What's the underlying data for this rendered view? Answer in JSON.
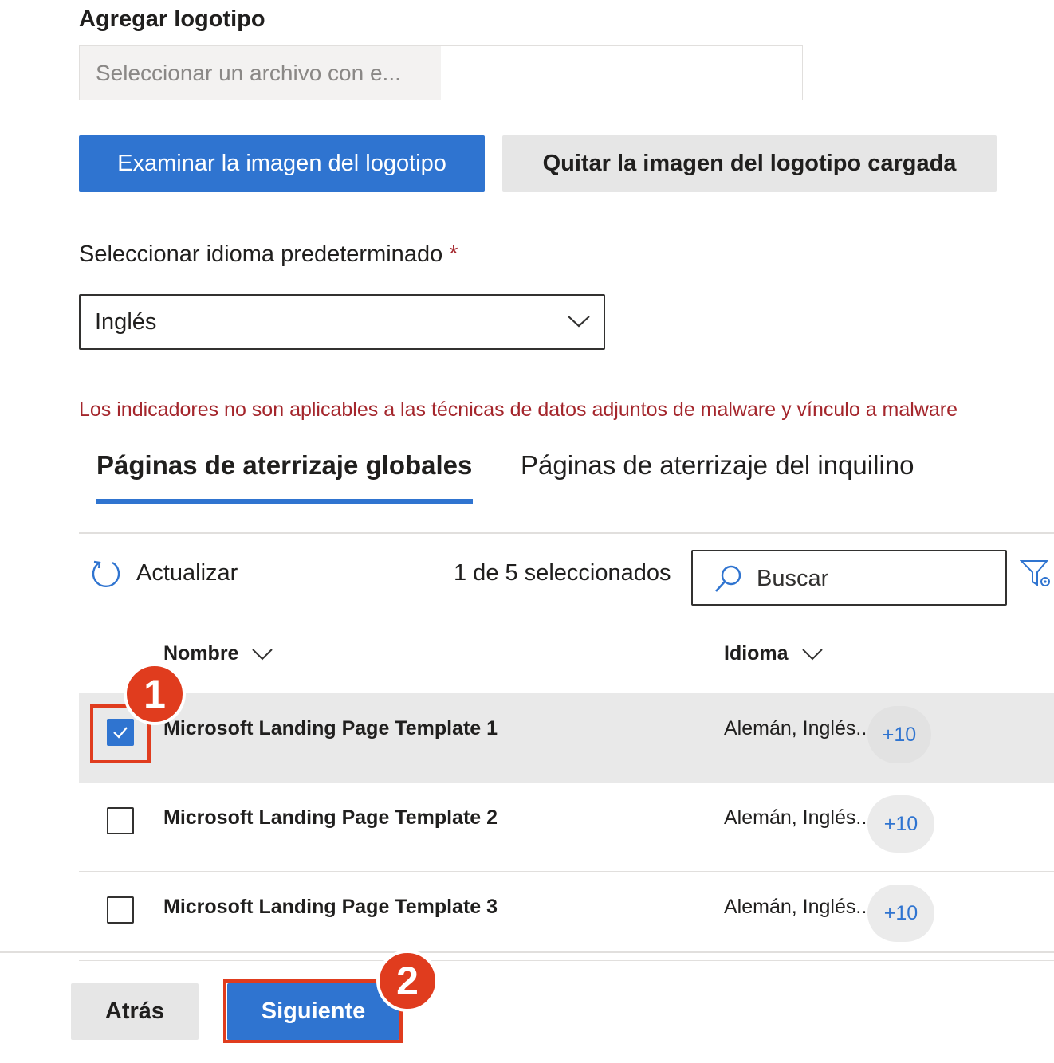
{
  "logo": {
    "label": "Agregar logotipo",
    "file_placeholder": "Seleccionar un archivo con e...",
    "browse_label": "Examinar la imagen del logotipo",
    "remove_label": "Quitar la imagen del logotipo cargada"
  },
  "language": {
    "label": "Seleccionar idioma predeterminado",
    "required_mark": "*",
    "selected": "Inglés"
  },
  "warning": "Los indicadores no son aplicables a las técnicas de datos adjuntos de malware y vínculo a malware",
  "tabs": [
    {
      "label": "Páginas de aterrizaje globales",
      "active": true
    },
    {
      "label": "Páginas de aterrizaje del inquilino",
      "active": false
    }
  ],
  "toolbar": {
    "refresh_label": "Actualizar",
    "selection_count": "1 de 5 seleccionados",
    "search_placeholder": "Buscar"
  },
  "table": {
    "columns": [
      "Nombre",
      "Idioma"
    ],
    "rows": [
      {
        "name": "Microsoft Landing Page Template 1",
        "languages": "Alemán, Inglés..",
        "more": "+10",
        "checked": true
      },
      {
        "name": "Microsoft Landing Page Template 2",
        "languages": "Alemán, Inglés..",
        "more": "+10",
        "checked": false
      },
      {
        "name": "Microsoft Landing Page Template 3",
        "languages": "Alemán, Inglés..",
        "more": "+10",
        "checked": false
      }
    ]
  },
  "footer": {
    "back_label": "Atrás",
    "next_label": "Siguiente"
  },
  "callouts": [
    "1",
    "2"
  ],
  "colors": {
    "accent": "#2f74d0",
    "warning": "#a4262c",
    "callout": "#e03c1e"
  }
}
